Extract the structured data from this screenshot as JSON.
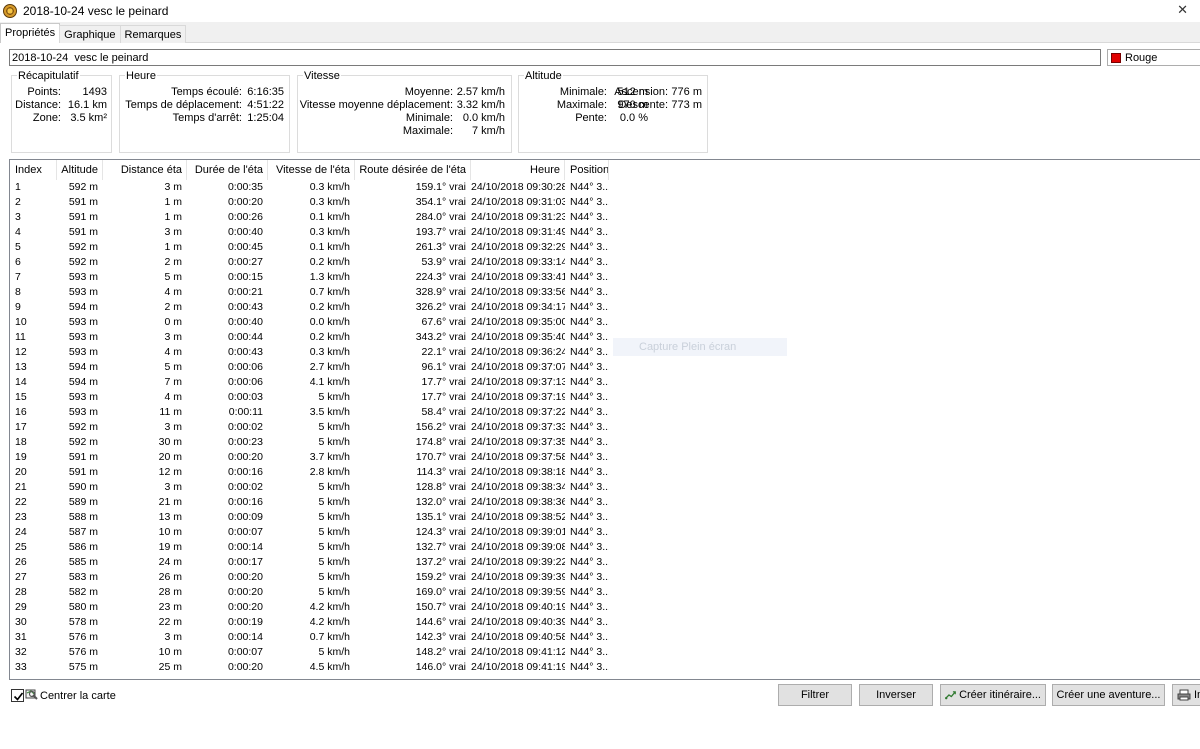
{
  "window": {
    "title": "2018-10-24  vesc le peinard",
    "close_glyph": "✕"
  },
  "tabs": [
    {
      "label": "Propriétés",
      "active": true
    },
    {
      "label": "Graphique",
      "active": false
    },
    {
      "label": "Remarques",
      "active": false
    }
  ],
  "track": {
    "name": "2018-10-24  vesc le peinard",
    "color_label": "Rouge",
    "color_hex": "#e00000"
  },
  "summary": {
    "recap": {
      "title": "Récapitulatif",
      "items": [
        {
          "label": "Points:",
          "value": "1493"
        },
        {
          "label": "Distance:",
          "value": "16.1 km"
        },
        {
          "label": "Zone:",
          "value": "3.5 km²"
        }
      ]
    },
    "time": {
      "title": "Heure",
      "items": [
        {
          "label": "Temps écoulé:",
          "value": "6:16:35"
        },
        {
          "label": "Temps de déplacement:",
          "value": "4:51:22"
        },
        {
          "label": "Temps d'arrêt:",
          "value": "1:25:04"
        }
      ]
    },
    "speed": {
      "title": "Vitesse",
      "items": [
        {
          "label": "Moyenne:",
          "value": "2.57 km/h"
        },
        {
          "label": "Vitesse moyenne déplacement:",
          "value": "3.32 km/h"
        },
        {
          "label": "Minimale:",
          "value": "0.0 km/h"
        },
        {
          "label": "Maximale:",
          "value": "7 km/h"
        }
      ]
    },
    "altitude": {
      "title": "Altitude",
      "items": [
        {
          "label": "Minimale:",
          "value": "512 m"
        },
        {
          "label": "Maximale:",
          "value": "970 m"
        },
        {
          "label": "Pente:",
          "value": "0.0 %"
        }
      ],
      "items2": [
        {
          "label": "Ascension:",
          "value": "776 m"
        },
        {
          "label": "Descente:",
          "value": "773 m"
        }
      ]
    }
  },
  "table": {
    "columns": [
      "Index",
      "Altitude",
      "Distance éta",
      "Durée de l'éta",
      "Vitesse de l'éta",
      "Route désirée de l'éta",
      "Heure",
      "Position"
    ],
    "rows": [
      [
        "1",
        "592 m",
        "3 m",
        "0:00:35",
        "0.3 km/h",
        "159.1° vrai",
        "24/10/2018 09:30:28",
        "N44° 3..."
      ],
      [
        "2",
        "591 m",
        "1 m",
        "0:00:20",
        "0.3 km/h",
        "354.1° vrai",
        "24/10/2018 09:31:03",
        "N44° 3..."
      ],
      [
        "3",
        "591 m",
        "1 m",
        "0:00:26",
        "0.1 km/h",
        "284.0° vrai",
        "24/10/2018 09:31:23",
        "N44° 3..."
      ],
      [
        "4",
        "591 m",
        "3 m",
        "0:00:40",
        "0.3 km/h",
        "193.7° vrai",
        "24/10/2018 09:31:49",
        "N44° 3..."
      ],
      [
        "5",
        "592 m",
        "1 m",
        "0:00:45",
        "0.1 km/h",
        "261.3° vrai",
        "24/10/2018 09:32:29",
        "N44° 3..."
      ],
      [
        "6",
        "592 m",
        "2 m",
        "0:00:27",
        "0.2 km/h",
        "53.9° vrai",
        "24/10/2018 09:33:14",
        "N44° 3..."
      ],
      [
        "7",
        "593 m",
        "5 m",
        "0:00:15",
        "1.3 km/h",
        "224.3° vrai",
        "24/10/2018 09:33:41",
        "N44° 3..."
      ],
      [
        "8",
        "593 m",
        "4 m",
        "0:00:21",
        "0.7 km/h",
        "328.9° vrai",
        "24/10/2018 09:33:56",
        "N44° 3..."
      ],
      [
        "9",
        "594 m",
        "2 m",
        "0:00:43",
        "0.2 km/h",
        "326.2° vrai",
        "24/10/2018 09:34:17",
        "N44° 3..."
      ],
      [
        "10",
        "593 m",
        "0 m",
        "0:00:40",
        "0.0 km/h",
        "67.6° vrai",
        "24/10/2018 09:35:00",
        "N44° 3..."
      ],
      [
        "11",
        "593 m",
        "3 m",
        "0:00:44",
        "0.2 km/h",
        "343.2° vrai",
        "24/10/2018 09:35:40",
        "N44° 3..."
      ],
      [
        "12",
        "593 m",
        "4 m",
        "0:00:43",
        "0.3 km/h",
        "22.1° vrai",
        "24/10/2018 09:36:24",
        "N44° 3..."
      ],
      [
        "13",
        "594 m",
        "5 m",
        "0:00:06",
        "2.7 km/h",
        "96.1° vrai",
        "24/10/2018 09:37:07",
        "N44° 3..."
      ],
      [
        "14",
        "594 m",
        "7 m",
        "0:00:06",
        "4.1 km/h",
        "17.7° vrai",
        "24/10/2018 09:37:13",
        "N44° 3..."
      ],
      [
        "15",
        "593 m",
        "4 m",
        "0:00:03",
        "5 km/h",
        "17.7° vrai",
        "24/10/2018 09:37:19",
        "N44° 3..."
      ],
      [
        "16",
        "593 m",
        "11 m",
        "0:00:11",
        "3.5 km/h",
        "58.4° vrai",
        "24/10/2018 09:37:22",
        "N44° 3..."
      ],
      [
        "17",
        "592 m",
        "3 m",
        "0:00:02",
        "5 km/h",
        "156.2° vrai",
        "24/10/2018 09:37:33",
        "N44° 3..."
      ],
      [
        "18",
        "592 m",
        "30 m",
        "0:00:23",
        "5 km/h",
        "174.8° vrai",
        "24/10/2018 09:37:35",
        "N44° 3..."
      ],
      [
        "19",
        "591 m",
        "20 m",
        "0:00:20",
        "3.7 km/h",
        "170.7° vrai",
        "24/10/2018 09:37:58",
        "N44° 3..."
      ],
      [
        "20",
        "591 m",
        "12 m",
        "0:00:16",
        "2.8 km/h",
        "114.3° vrai",
        "24/10/2018 09:38:18",
        "N44° 3..."
      ],
      [
        "21",
        "590 m",
        "3 m",
        "0:00:02",
        "5 km/h",
        "128.8° vrai",
        "24/10/2018 09:38:34",
        "N44° 3..."
      ],
      [
        "22",
        "589 m",
        "21 m",
        "0:00:16",
        "5 km/h",
        "132.0° vrai",
        "24/10/2018 09:38:36",
        "N44° 3..."
      ],
      [
        "23",
        "588 m",
        "13 m",
        "0:00:09",
        "5 km/h",
        "135.1° vrai",
        "24/10/2018 09:38:52",
        "N44° 3..."
      ],
      [
        "24",
        "587 m",
        "10 m",
        "0:00:07",
        "5 km/h",
        "124.3° vrai",
        "24/10/2018 09:39:01",
        "N44° 3..."
      ],
      [
        "25",
        "586 m",
        "19 m",
        "0:00:14",
        "5 km/h",
        "132.7° vrai",
        "24/10/2018 09:39:08",
        "N44° 3..."
      ],
      [
        "26",
        "585 m",
        "24 m",
        "0:00:17",
        "5 km/h",
        "137.2° vrai",
        "24/10/2018 09:39:22",
        "N44° 3..."
      ],
      [
        "27",
        "583 m",
        "26 m",
        "0:00:20",
        "5 km/h",
        "159.2° vrai",
        "24/10/2018 09:39:39",
        "N44° 3..."
      ],
      [
        "28",
        "582 m",
        "28 m",
        "0:00:20",
        "5 km/h",
        "169.0° vrai",
        "24/10/2018 09:39:59",
        "N44° 3..."
      ],
      [
        "29",
        "580 m",
        "23 m",
        "0:00:20",
        "4.2 km/h",
        "150.7° vrai",
        "24/10/2018 09:40:19",
        "N44° 3..."
      ],
      [
        "30",
        "578 m",
        "22 m",
        "0:00:19",
        "4.2 km/h",
        "144.6° vrai",
        "24/10/2018 09:40:39",
        "N44° 3..."
      ],
      [
        "31",
        "576 m",
        "3 m",
        "0:00:14",
        "0.7 km/h",
        "142.3° vrai",
        "24/10/2018 09:40:58",
        "N44° 3..."
      ],
      [
        "32",
        "576 m",
        "10 m",
        "0:00:07",
        "5 km/h",
        "148.2° vrai",
        "24/10/2018 09:41:12",
        "N44° 3..."
      ],
      [
        "33",
        "575 m",
        "25 m",
        "0:00:20",
        "4.5 km/h",
        "146.0° vrai",
        "24/10/2018 09:41:19",
        "N44° 3..."
      ]
    ],
    "watermark": "Capture Plein écran"
  },
  "footer": {
    "center_map_label": "Centrer la carte",
    "center_map_checked": true,
    "buttons": {
      "filter": "Filtrer",
      "reverse": "Inverser",
      "create_route": "Créer itinéraire...",
      "create_adventure": "Créer une aventure...",
      "print": "Im"
    }
  }
}
